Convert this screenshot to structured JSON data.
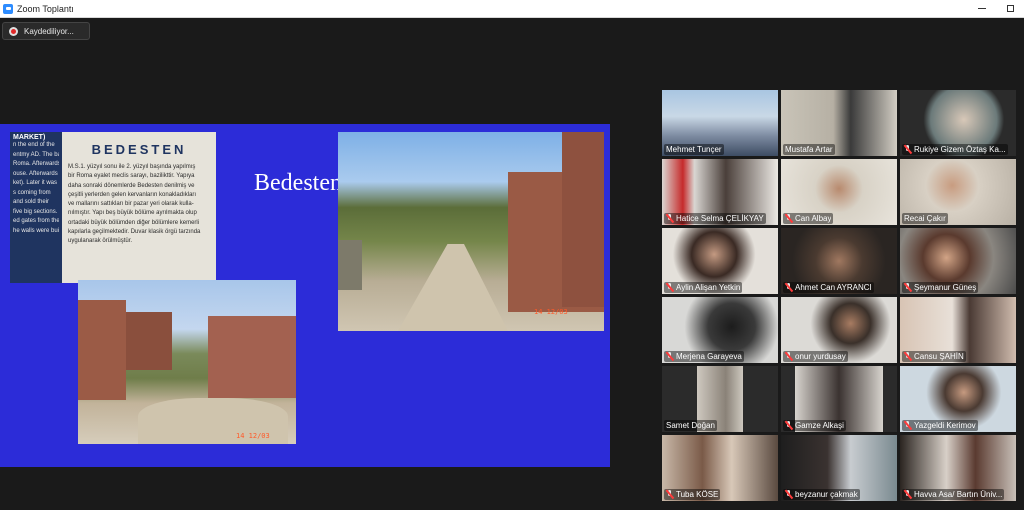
{
  "window": {
    "title": "Zoom Toplantı"
  },
  "recording": {
    "label": "Kaydediliyor..."
  },
  "slide": {
    "title": "Bedesten",
    "sign": {
      "heading": "BEDESTEN",
      "left_header": "MARKET)",
      "left_lines": [
        "n the end of the",
        "entmy AD. The basi",
        "Roma. Afterwards",
        "ouse. Afterwards",
        "ket). Later it was",
        "s coming from",
        "and sold their",
        "five big sections.",
        "ed gates from the",
        "he walls were built"
      ],
      "right_lines": [
        "M.S.1. yüzyıl sonu ile 2. yüzyıl başında yapılmış",
        "bir Roma eyalet meclis sarayı, bazilikttir. Yapıya",
        "daha sonraki dönemlerde Bedesten denilmiş ve",
        "çeşitli yerlerden gelen kervanların konakladıkları",
        "ve mallarını sattıkları bir pazar yeri olarak kulla-",
        "nılmıştır. Yapı beş büyük bölüme ayrılmakta olup",
        "ortadaki büyük bölümden diğer bölümlere kemerli",
        "kapılarla geçilmektedir. Duvar klasik örgü tarzında",
        "uygulanarak örülmüştür."
      ]
    },
    "photo_left_date": "14 12/03",
    "photo_right_date": "14 12/03"
  },
  "participants": [
    {
      "name": "Mehmet Tunçer",
      "muted": false,
      "active": true
    },
    {
      "name": "Mustafa Artar",
      "muted": false,
      "active": false
    },
    {
      "name": "Rukiye Gizem Öztaş Ka...",
      "muted": true,
      "active": false
    },
    {
      "name": "Hatice Selma ÇELİKYAY",
      "muted": true,
      "active": false
    },
    {
      "name": "Can Albay",
      "muted": true,
      "active": false
    },
    {
      "name": "Recai Çakır",
      "muted": false,
      "active": false
    },
    {
      "name": "Aylin Alişan Yetkin",
      "muted": true,
      "active": false
    },
    {
      "name": "Ahmet Can AYRANCI",
      "muted": true,
      "active": false
    },
    {
      "name": "Şeymanur Güneş",
      "muted": true,
      "active": false
    },
    {
      "name": "Merjena Garayeva",
      "muted": true,
      "active": false
    },
    {
      "name": "onur yurdusay",
      "muted": true,
      "active": false
    },
    {
      "name": "Cansu ŞAHİN",
      "muted": true,
      "active": false
    },
    {
      "name": "Samet Doğan",
      "muted": false,
      "active": false
    },
    {
      "name": "Gamze Alkaşi",
      "muted": true,
      "active": false
    },
    {
      "name": "Yazgeldi Kerimov",
      "muted": true,
      "active": false
    },
    {
      "name": "Tuba KÖSE",
      "muted": true,
      "active": false
    },
    {
      "name": "beyzanur çakmak",
      "muted": true,
      "active": false
    },
    {
      "name": "Havva Asa/ Bartın Üniv...",
      "muted": true,
      "active": false
    }
  ]
}
